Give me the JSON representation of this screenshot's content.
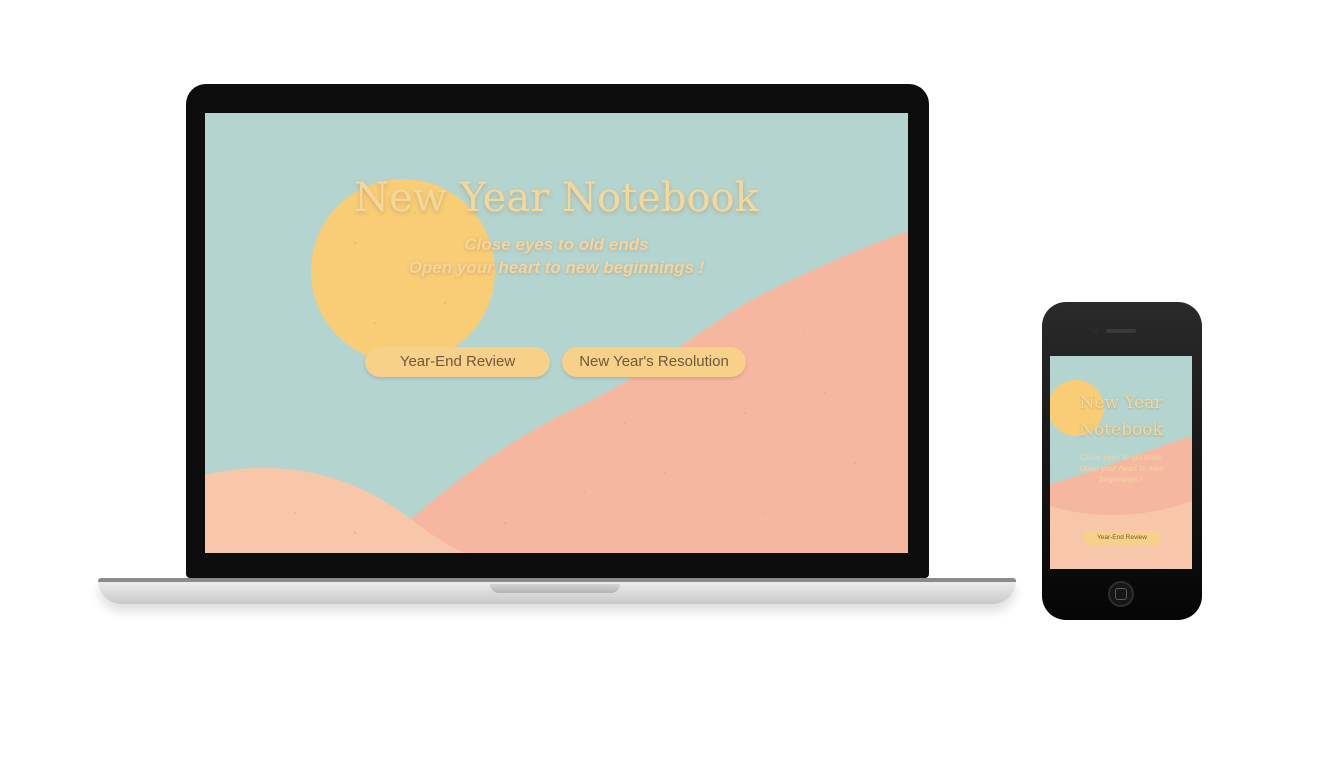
{
  "desktop": {
    "title": "New Year Notebook",
    "subtitle_line1": "Close eyes to old ends",
    "subtitle_line2": "Open your heart to new beginnings !",
    "buttons": {
      "review": "Year-End Review",
      "resolution": "New Year's Resolution"
    }
  },
  "mobile": {
    "title_line1": "New Year",
    "title_line2": "Notebook",
    "subtitle_line1": "Close eyes to old ends",
    "subtitle_line2": "Open your heart to new",
    "subtitle_line3": "beginnings !",
    "buttons": {
      "review": "Year-End Review"
    }
  },
  "colors": {
    "background_teal": "#b4d4cf",
    "hill_salmon": "#f6b7a0",
    "hill_peach": "#f8c6a9",
    "sun_yellow": "#f8cd76",
    "button_fill": "#f7d08a",
    "title_text": "#f4d79a",
    "button_text": "#70583c"
  }
}
